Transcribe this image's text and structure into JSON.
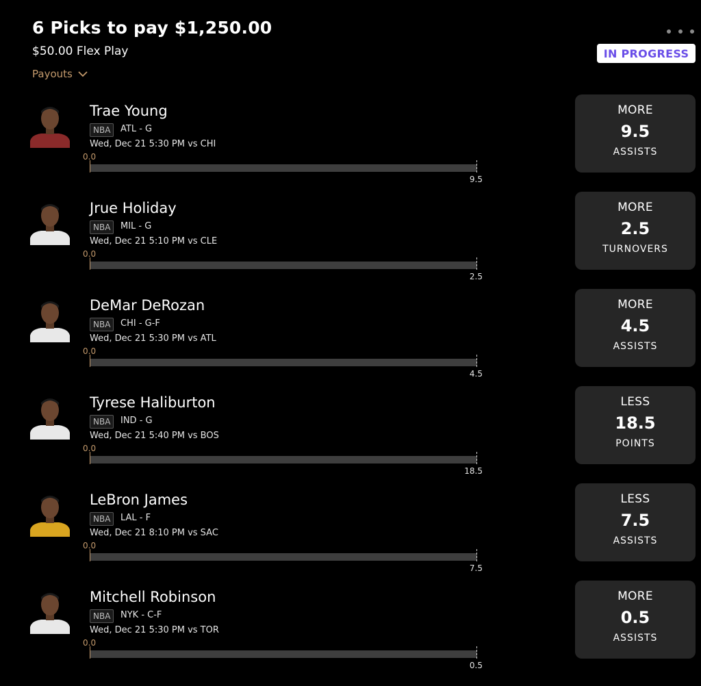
{
  "header": {
    "title": "6 Picks to pay $1,250.00",
    "subtitle": "$50.00 Flex Play",
    "payouts_label": "Payouts",
    "status": "IN PROGRESS"
  },
  "colors": {
    "background": "#000000",
    "card": "#262626",
    "accent_tan": "#c49a6c",
    "status_text": "#6a4ee8",
    "track": "#3e3e3e"
  },
  "picks": [
    {
      "name": "Trae Young",
      "league": "NBA",
      "team_pos": "ATL - G",
      "game": "Wed, Dec 21 5:30 PM  vs CHI",
      "current": "0.0",
      "line": "9.5",
      "progress": 0,
      "direction": "MORE",
      "stat": "ASSISTS",
      "jersey_color": "#8a2a2a"
    },
    {
      "name": "Jrue Holiday",
      "league": "NBA",
      "team_pos": "MIL - G",
      "game": "Wed, Dec 21 5:10 PM  vs CLE",
      "current": "0.0",
      "line": "2.5",
      "progress": 0,
      "direction": "MORE",
      "stat": "TURNOVERS",
      "jersey_color": "#e8e8e8"
    },
    {
      "name": "DeMar DeRozan",
      "league": "NBA",
      "team_pos": "CHI - G-F",
      "game": "Wed, Dec 21 5:30 PM  vs ATL",
      "current": "0.0",
      "line": "4.5",
      "progress": 0,
      "direction": "MORE",
      "stat": "ASSISTS",
      "jersey_color": "#e8e8e8"
    },
    {
      "name": "Tyrese Haliburton",
      "league": "NBA",
      "team_pos": "IND - G",
      "game": "Wed, Dec 21 5:40 PM  vs BOS",
      "current": "0.0",
      "line": "18.5",
      "progress": 0,
      "direction": "LESS",
      "stat": "POINTS",
      "jersey_color": "#e8e8e8"
    },
    {
      "name": "LeBron James",
      "league": "NBA",
      "team_pos": "LAL - F",
      "game": "Wed, Dec 21 8:10 PM  vs SAC",
      "current": "0.0",
      "line": "7.5",
      "progress": 0,
      "direction": "LESS",
      "stat": "ASSISTS",
      "jersey_color": "#d9a520"
    },
    {
      "name": "Mitchell Robinson",
      "league": "NBA",
      "team_pos": "NYK - C-F",
      "game": "Wed, Dec 21 5:30 PM  vs TOR",
      "current": "0.0",
      "line": "0.5",
      "progress": 0,
      "direction": "MORE",
      "stat": "ASSISTS",
      "jersey_color": "#e8e8e8"
    }
  ]
}
